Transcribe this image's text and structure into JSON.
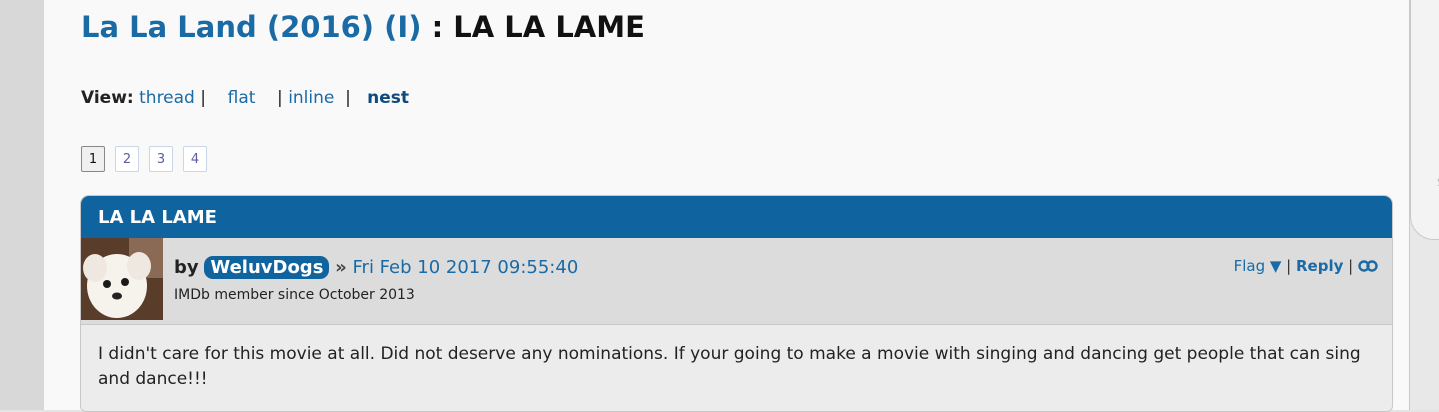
{
  "title": {
    "movie_link": "La La Land (2016) (I)",
    "separator": ":",
    "thread_name": "LA LA LAME"
  },
  "view": {
    "label": "View:",
    "options": [
      "thread",
      "flat",
      "inline",
      "nest"
    ],
    "current": "nest"
  },
  "pagination": {
    "pages": [
      "1",
      "2",
      "3",
      "4"
    ],
    "current": "1"
  },
  "post": {
    "header": "LA LA LAME",
    "by_label": "by",
    "username": "WeluvDogs",
    "arrow": "»",
    "date": "Fri Feb 10 2017 09:55:40",
    "member_since": "IMDb member since October 2013",
    "actions": {
      "flag": "Flag ▼",
      "reply": "Reply",
      "permalink_icon": "link-icon"
    },
    "body": "I didn't care for this movie at all. Did not deserve any nominations. If your going to make a movie with singing and dancing get people that can sing and dance!!!"
  },
  "right_panel": {
    "edge_char": "S"
  },
  "colors": {
    "link_blue": "#1a6aa6",
    "header_blue": "#0f64a0",
    "meta_gray": "#dcdcdc",
    "body_gray": "#ececec"
  }
}
